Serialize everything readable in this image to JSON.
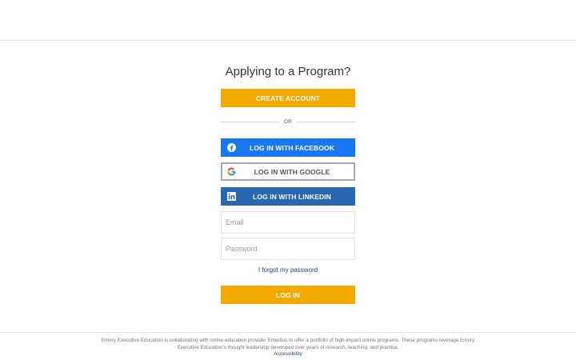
{
  "page": {
    "title": "Applying to a Program?"
  },
  "buttons": {
    "create_account": "CREATE ACCOUNT",
    "divider_text": "OR",
    "facebook": "LOG IN WITH FACEBOOK",
    "google": "LOG IN WITH GOOGLE",
    "linkedin": "LOG IN WITH LINKEDIN",
    "login": "LOG IN"
  },
  "form": {
    "email_placeholder": "Email",
    "email_value": "",
    "password_placeholder": "Password",
    "password_value": "",
    "forgot_password": "I forgot my password"
  },
  "footer": {
    "text": "Emory Executive Education is collaborating with online education provider Emeritus to offer a portfolio of high-impact online programs. These programs leverage Emory Executive Education's thought leadership developed over years of research, teaching, and practice.",
    "accessibility_link": "Accessibility"
  },
  "icons": {
    "facebook": "facebook-icon",
    "google": "google-icon",
    "linkedin": "linkedin-icon"
  },
  "colors": {
    "accent": "#f2a900",
    "facebook": "#1877f2",
    "linkedin": "#2a67b2",
    "link": "#2a3f7a"
  }
}
